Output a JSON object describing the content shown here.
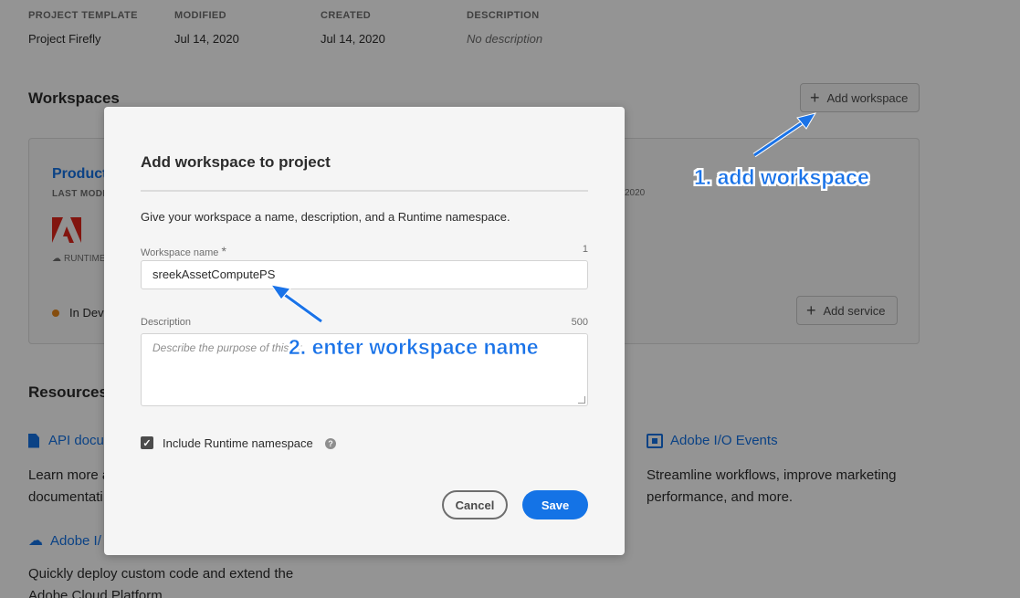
{
  "project_meta": {
    "template_label": "PROJECT TEMPLATE",
    "template_value": "Project Firefly",
    "modified_label": "MODIFIED",
    "modified_value": "Jul 14, 2020",
    "created_label": "CREATED",
    "created_value": "Jul 14, 2020",
    "description_label": "DESCRIPTION",
    "description_value": "No description"
  },
  "workspaces": {
    "title": "Workspaces",
    "add_button": "Add workspace",
    "card": {
      "name": "Product",
      "last_modified_label": "LAST MODI",
      "date_suffix": "2020",
      "runtime_label": "RUNTIME",
      "status": "In Deve",
      "add_service_button": "Add service"
    }
  },
  "resources": {
    "title": "Resources",
    "api_docs_link": "API docu",
    "api_docs_text_1": "Learn more a",
    "api_docs_text_2": "documentati",
    "io_link": "Adobe I/",
    "io_text_1": "Quickly deploy custom code and extend the",
    "io_text_2": "Adobe Cloud Platform",
    "events_link": "Adobe I/O Events",
    "events_text_1": "Streamline workflows, improve marketing",
    "events_text_2": "performance, and more."
  },
  "modal": {
    "title": "Add workspace to project",
    "description": "Give your workspace a name, description, and a Runtime namespace.",
    "name_label": "Workspace name",
    "name_required": "*",
    "name_counter": "1",
    "name_value": "sreekAssetComputePS",
    "desc_label": "Description",
    "desc_counter": "500",
    "desc_placeholder": "Describe the purpose of this pr",
    "runtime_checkbox_label": "Include Runtime namespace",
    "runtime_checked": true,
    "cancel_button": "Cancel",
    "save_button": "Save"
  },
  "annotations": {
    "step1": "1. add workspace",
    "step2": "2. enter workspace name"
  },
  "colors": {
    "accent": "#1473e6",
    "annotation": "#1a73e8",
    "adobe_red": "#e1251b",
    "status_orange": "#e68619"
  }
}
